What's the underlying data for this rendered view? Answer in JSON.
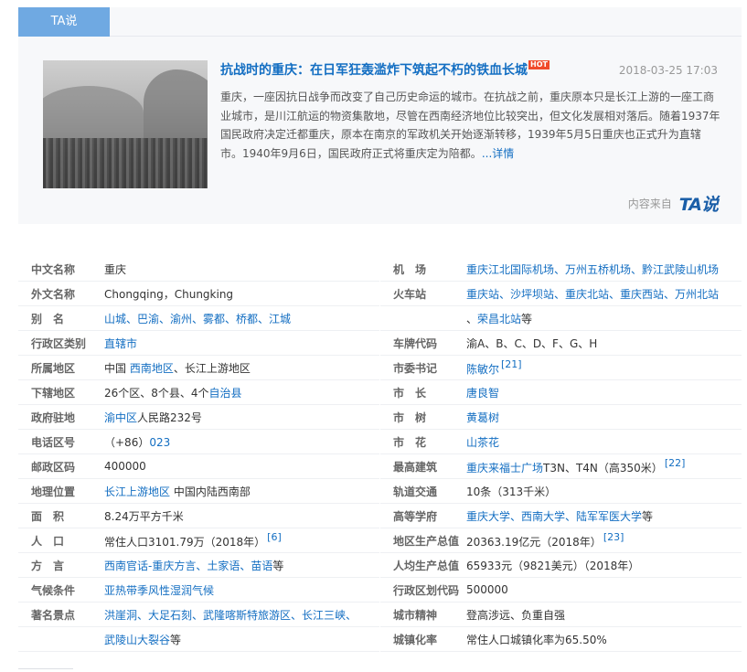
{
  "ta": {
    "tab_label": "TA说",
    "title": "抗战时的重庆：在日军狂轰滥炸下筑起不朽的铁血长城",
    "hot": "HOT",
    "date": "2018-03-25 17:03",
    "summary": "重庆，一座因抗日战争而改变了自己历史命运的城市。在抗战之前，重庆原本只是长江上游的一座工商业城市，是川江航运的物资集散地，尽管在西南经济地位比较突出，但文化发展相对落后。随着1937年国民政府决定迁都重庆，原本在南京的军政机关开始逐渐转移，1939年5月5日重庆也正式升为直辖市。1940年9月6日，国民政府正式将重庆定为陪都。",
    "more": "...详情",
    "source_label": "内容来自",
    "logo": "TA说"
  },
  "info_left": [
    {
      "label": "中文名称",
      "value": "重庆"
    },
    {
      "label": "外文名称",
      "value": "Chongqing，Chungking"
    },
    {
      "label": "别　名",
      "value": "山城、巴渝、渝州、雾都、桥都、江城",
      "link": true
    },
    {
      "label": "行政区类别",
      "value": "直辖市",
      "link": true
    },
    {
      "label": "所属地区",
      "value": "中国 ",
      "value_link": "西南地区",
      "value_tail": "、长江上游地区"
    },
    {
      "label": "下辖地区",
      "value": "26个区、8个县、4个",
      "value_link": "自治县"
    },
    {
      "label": "政府驻地",
      "value": "",
      "value_link": "渝中区",
      "value_tail": "人民路232号"
    },
    {
      "label": "电话区号",
      "value": "（+86）",
      "value_link": "023"
    },
    {
      "label": "邮政区码",
      "value": "400000"
    },
    {
      "label": "地理位置",
      "value": "",
      "value_link": "长江上游地区",
      "value_tail": " 中国内陆西南部"
    },
    {
      "label": "面　积",
      "value": "8.24万平方千米"
    },
    {
      "label": "人　口",
      "value": "常住人口3101.79万（2018年）",
      "sup": "[6]"
    },
    {
      "label": "方　言",
      "value": "",
      "value_link": "西南官话-重庆方言、土家语、苗语",
      "value_tail": "等"
    },
    {
      "label": "气候条件",
      "value": "亚热带季风性湿润气候",
      "link": true
    },
    {
      "label": "著名景点",
      "value": "洪崖洞、大足石刻、武隆喀斯特旅游区、长江三峡、",
      "link": true
    },
    {
      "label": "",
      "value": "",
      "value_link": "武陵山大裂谷",
      "value_tail": "等"
    }
  ],
  "info_right": [
    {
      "label": "机　场",
      "value": "重庆江北国际机场、万州五桥机场、黔江武陵山机场",
      "link": true
    },
    {
      "label": "火车站",
      "value": "重庆站、沙坪坝站、重庆北站、重庆西站、万州北站",
      "link": true
    },
    {
      "label": "",
      "value": "、",
      "value_link": "荣昌北站",
      "value_tail": "等"
    },
    {
      "label": "车牌代码",
      "value": "渝A、B、C、D、F、G、H"
    },
    {
      "label": "市委书记",
      "value": "",
      "value_link": "陈敏尔",
      "sup": "[21]"
    },
    {
      "label": "市　长",
      "value": "唐良智",
      "link": true
    },
    {
      "label": "市　树",
      "value": "黄葛树",
      "link": true
    },
    {
      "label": "市　花",
      "value": "山茶花",
      "link": true
    },
    {
      "label": "最高建筑",
      "value": "",
      "value_link": "重庆来福士广场",
      "value_tail": "T3N、T4N（高350米）",
      "sup": "[22]"
    },
    {
      "label": "轨道交通",
      "value": "10条（313千米）"
    },
    {
      "label": "高等学府",
      "value": "",
      "value_link": "重庆大学、西南大学、陆军军医大学",
      "value_tail": "等"
    },
    {
      "label": "地区生产总值",
      "value": "20363.19亿元（2018年）",
      "sup": "[23]"
    },
    {
      "label": "人均生产总值",
      "value": "65933元（9821美元）（2018年）"
    },
    {
      "label": "行政区划代码",
      "value": "500000"
    },
    {
      "label": "城市精神",
      "value": "登高涉远、负重自强"
    },
    {
      "label": "城镇化率",
      "value": "常住人口城镇化率为65.50%"
    }
  ]
}
